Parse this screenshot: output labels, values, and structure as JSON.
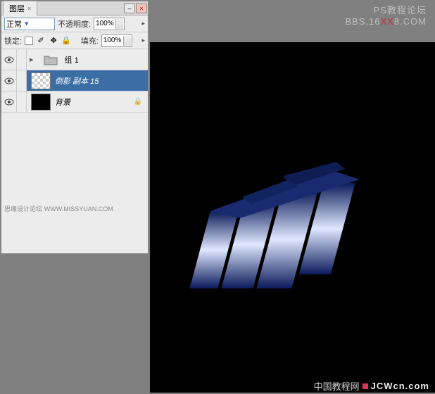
{
  "panel": {
    "tab": "图层",
    "blendMode": "正常",
    "opacityLabel": "不透明度:",
    "opacityValue": "100%",
    "lockLabel": "锁定:",
    "fillLabel": "填充:",
    "fillValue": "100%"
  },
  "layers": [
    {
      "name": "组 1",
      "type": "group",
      "italic": false
    },
    {
      "name": "倒影 副本 15",
      "type": "checker",
      "italic": true,
      "selected": true
    },
    {
      "name": "背景",
      "type": "black",
      "italic": true,
      "locked": true
    }
  ],
  "watermarks": {
    "panel": "思缘设计论坛",
    "panelUrl": "WWW.MISSYUAN.COM",
    "topLine1": "PS教程论坛",
    "topLine2a": "BBS.16",
    "topLine2b": "XX",
    "topLine2c": "8.COM",
    "footer1": "中国教程网",
    "footer2": "JCWcn.com"
  }
}
